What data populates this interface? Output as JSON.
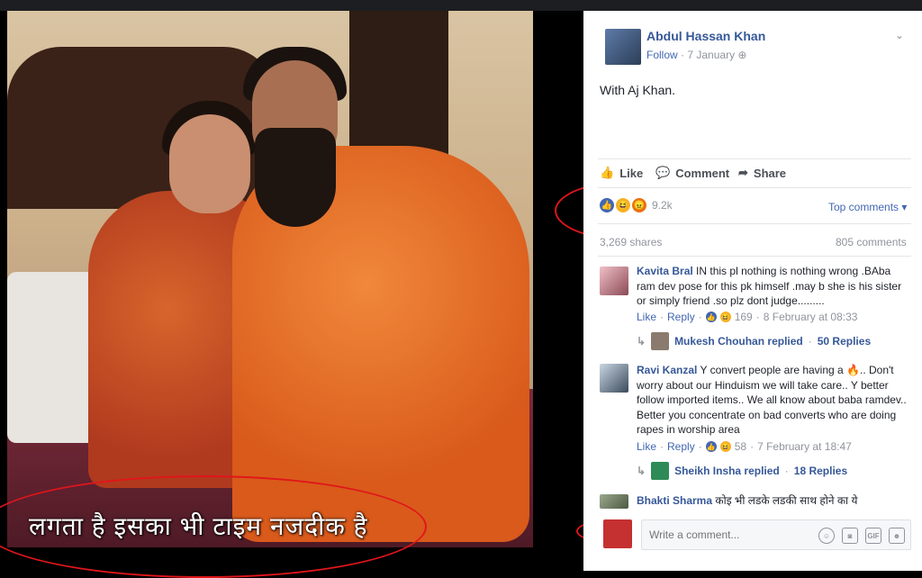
{
  "photo": {
    "caption": "लगता है इसका भी टाइम नजदीक है"
  },
  "post": {
    "author": "Abdul Hassan Khan",
    "follow_label": "Follow",
    "date": "7 January",
    "text": "With Aj Khan."
  },
  "actions": {
    "like": "Like",
    "comment": "Comment",
    "share": "Share"
  },
  "stats": {
    "reaction_count": "9.2k",
    "sort_label": "Top comments",
    "shares": "3,269 shares",
    "comments": "805 comments"
  },
  "comments": [
    {
      "name": "Kavita Bral",
      "text": "IN this pl nothing is nothing wrong .BAba ram dev pose for this pk himself .may b she is his sister or simply friend .so plz dont judge.........",
      "like": "Like",
      "reply": "Reply",
      "reaction_count": "169",
      "time": "8 February at 08:33",
      "reply_summary_name": "Mukesh Chouhan replied",
      "reply_summary_count": "50 Replies"
    },
    {
      "name": "Ravi Kanzal",
      "text": "Y convert people are having a 🔥.. Don't worry about our Hinduism we will take care.. Y better follow imported items.. We all know about baba ramdev.. Better you concentrate on bad converts who are doing rapes in worship area",
      "like": "Like",
      "reply": "Reply",
      "reaction_count": "58",
      "time": "7 February at 18:47",
      "reply_summary_name": "Sheikh Insha replied",
      "reply_summary_count": "18 Replies"
    },
    {
      "name": "Bhakti Sharma",
      "text": "कोइ भी लडके लडकी साथ होने का ये"
    }
  ],
  "composer": {
    "placeholder": "Write a comment..."
  },
  "colors": {
    "link": "#365899",
    "annotation_red": "#e0151b",
    "like_blue": "#4267b2"
  }
}
